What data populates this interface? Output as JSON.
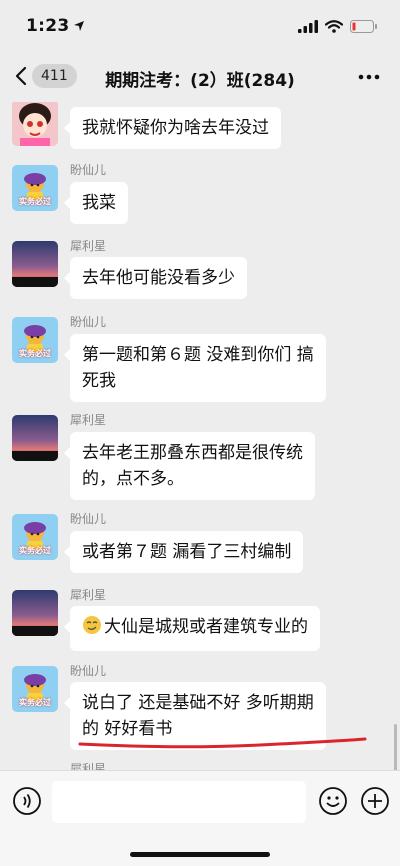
{
  "status_bar": {
    "time": "1:23",
    "icons": [
      "location-arrow-icon",
      "signal-icon",
      "wifi-icon",
      "battery-low-icon"
    ]
  },
  "nav": {
    "back_badge": "411",
    "title": "期期注考：(2）班(284)",
    "icons": [
      "chevron-left-icon",
      "more-icon"
    ]
  },
  "messages": [
    {
      "sender": "",
      "avatar": "cartoon-girl-avatar",
      "text": "我就怀疑你为啥去年没过"
    },
    {
      "sender": "盼仙儿",
      "avatar": "sticker-avatar",
      "text": "我菜",
      "avatar_caption": "实务必过"
    },
    {
      "sender": "犀利星",
      "avatar": "sunset-avatar",
      "text": "去年他可能没看多少"
    },
    {
      "sender": "盼仙儿",
      "avatar": "sticker-avatar",
      "text_lines": [
        "第一题和第６题 没难到你们 搞",
        "死我"
      ],
      "avatar_caption": "实务必过"
    },
    {
      "sender": "犀利星",
      "avatar": "sunset-avatar",
      "text_lines": [
        "去年老王那叠东西都是很传统",
        "的，点不多。"
      ]
    },
    {
      "sender": "盼仙儿",
      "avatar": "sticker-avatar",
      "text": "或者第７题 漏看了三村编制",
      "avatar_caption": "实务必过"
    },
    {
      "sender": "犀利星",
      "avatar": "sunset-avatar",
      "text": "大仙是城规或者建筑专业的",
      "emoji": "emoji-face-icon"
    },
    {
      "sender": "盼仙儿",
      "avatar": "sticker-avatar",
      "text_lines": [
        "说白了 还是基础不好 多听期期",
        "的 好好看书"
      ],
      "avatar_caption": "实务必过"
    },
    {
      "sender": "犀利星",
      "avatar": "sunset-avatar",
      "text": ""
    }
  ],
  "annotation": {
    "color": "#d9262c",
    "type": "hand-drawn-underline"
  },
  "input_bar": {
    "icons": [
      "voice-icon",
      "emoji-icon",
      "plus-icon"
    ],
    "placeholder": ""
  }
}
